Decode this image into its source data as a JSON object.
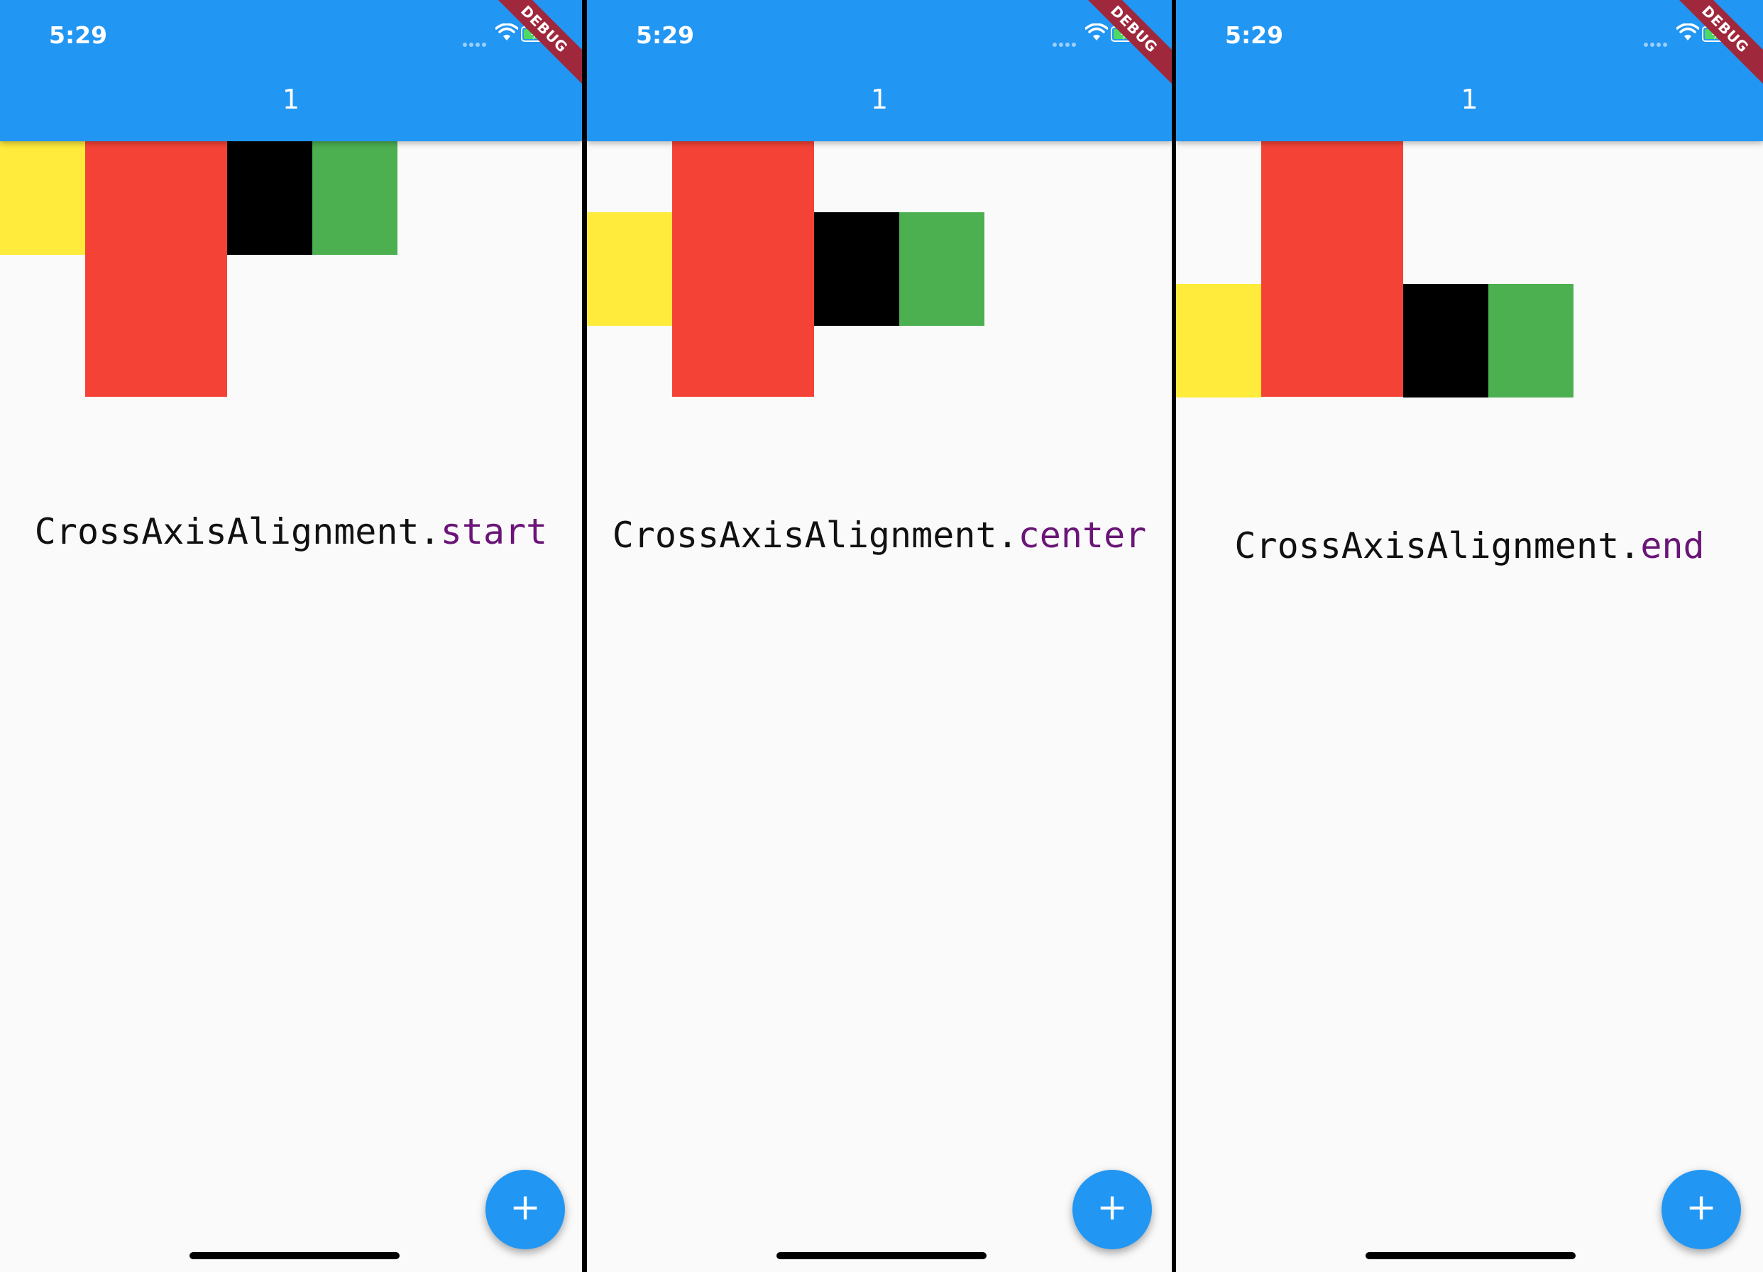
{
  "panels": [
    {
      "status_time": "5:29",
      "title": "1",
      "debug_label": "DEBUG",
      "caption_prefix": "CrossAxisAlignment.",
      "caption_member": "start",
      "fab_label": "+"
    },
    {
      "status_time": "5:29",
      "title": "1",
      "debug_label": "DEBUG",
      "caption_prefix": "CrossAxisAlignment.",
      "caption_member": "center",
      "fab_label": "+"
    },
    {
      "status_time": "5:29",
      "title": "1",
      "debug_label": "DEBUG",
      "caption_prefix": "CrossAxisAlignment.",
      "caption_member": "end",
      "fab_label": "+"
    }
  ],
  "colors": {
    "app_bar": "#2196f3",
    "box_yellow": "#ffeb3b",
    "box_red": "#f44336",
    "box_black": "#000000",
    "box_green": "#4caf50",
    "keyword": "#6a1577"
  }
}
